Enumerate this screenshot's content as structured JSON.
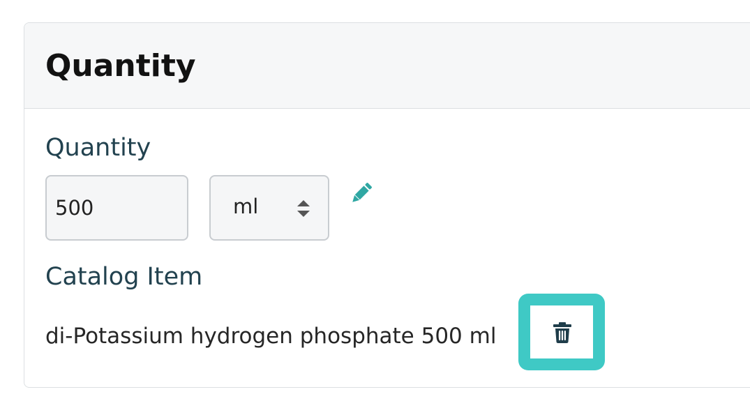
{
  "card": {
    "title": "Quantity"
  },
  "quantity_field": {
    "label": "Quantity",
    "value": "500",
    "unit": "ml"
  },
  "catalog_item": {
    "label": "Catalog Item",
    "name": "di-Potassium hydrogen phosphate 500 ml"
  },
  "icons": {
    "edit": "pencil-icon",
    "delete": "trash-icon",
    "select": "sort-arrows-icon"
  },
  "colors": {
    "label_text": "#22424f",
    "accent_teal": "#2fa7a3",
    "highlight_border": "#3fc9c5",
    "trash_icon": "#1f3d4a"
  }
}
